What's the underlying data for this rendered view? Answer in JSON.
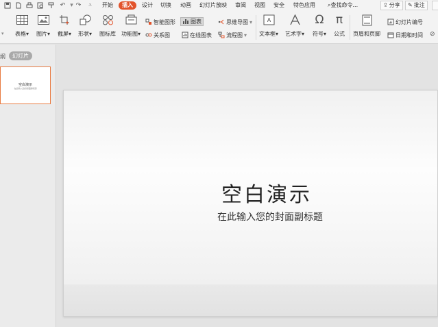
{
  "tabs": [
    "开始",
    "插入",
    "设计",
    "切换",
    "动画",
    "幻灯片放映",
    "审阅",
    "视图",
    "安全",
    "特色应用"
  ],
  "active_tab": "插入",
  "search_text": "查找命令...",
  "right_buttons": {
    "share": "分享",
    "comment": "批注"
  },
  "ribbon": {
    "table": "表格",
    "picture": "图片",
    "screenshot": "截屏",
    "shape": "形状",
    "icon_lib": "图标库",
    "func_chart": "功能图",
    "smart_graphic": "智能图形",
    "chart": "图表",
    "relation": "关系图",
    "online_chart": "在线图表",
    "mindmap": "思维导图",
    "flowchart": "流程图",
    "textbox": "文本框",
    "art_text": "艺术字",
    "symbol": "符号",
    "formula": "公式",
    "header_footer": "页眉和页脚",
    "slide_number": "幻灯片编号",
    "date_time": "日期和时间"
  },
  "left_pane": {
    "outline_tab": "纲",
    "slides_tab": "幻灯片"
  },
  "thumbnail": {
    "title": "空白演示",
    "subtitle": "在此输入您的封面副标题"
  },
  "slide": {
    "title": "空白演示",
    "subtitle": "在此输入您的封面副标题"
  },
  "colors": {
    "accent": "#e2542c",
    "selection": "#e8793f"
  }
}
